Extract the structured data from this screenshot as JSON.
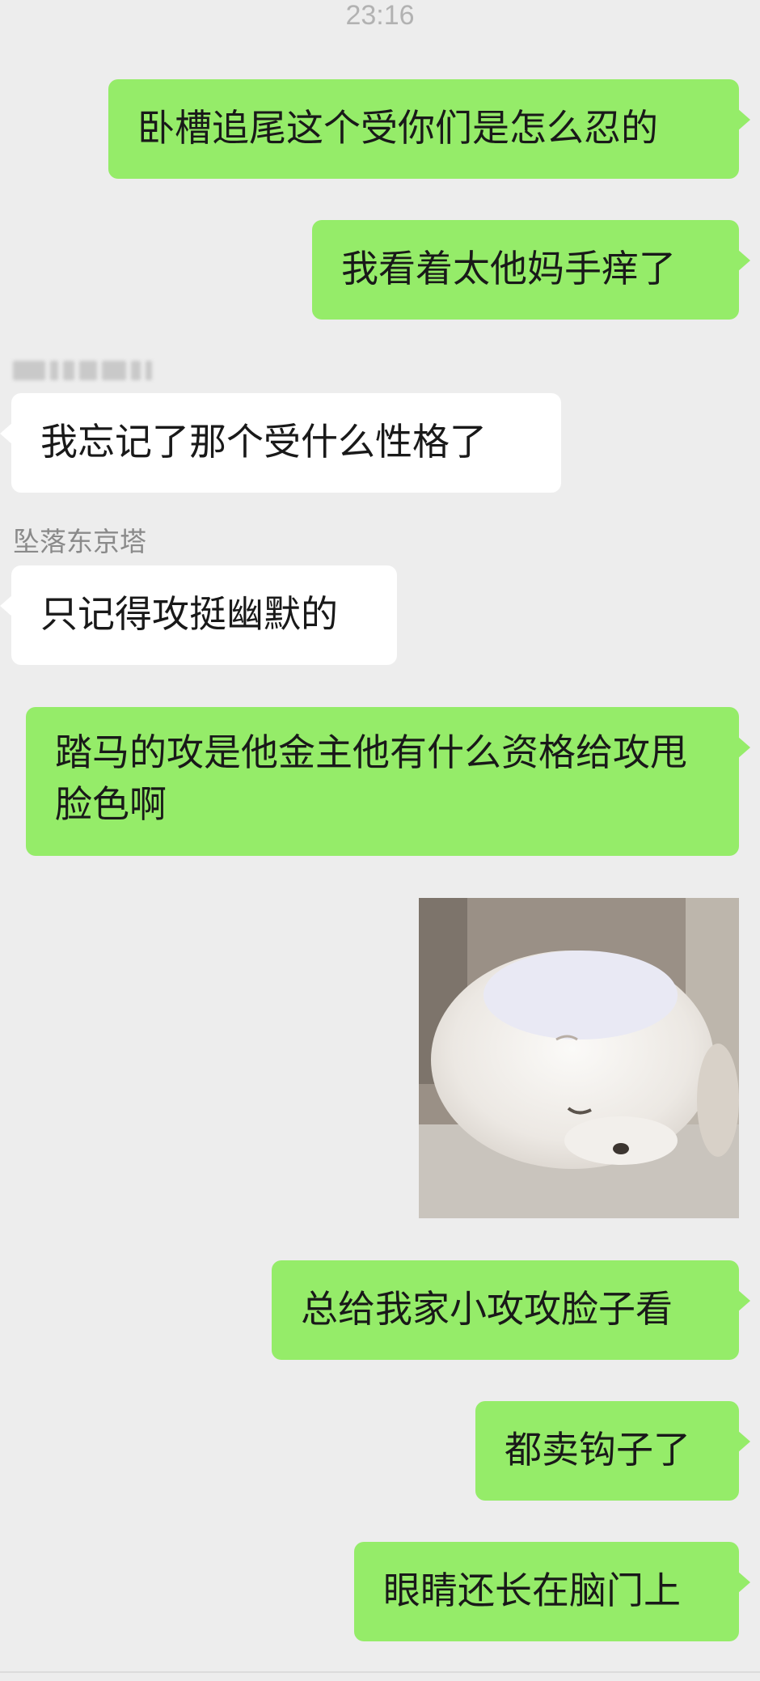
{
  "chat": {
    "timestamp": "23:16",
    "sender_name": "坠落东京塔",
    "messages": {
      "m1": "卧槽追尾这个受你们是怎么忍的",
      "m2": "我看着太他妈手痒了",
      "m3": "我忘记了那个受什么性格了",
      "m4": "只记得攻挺幽默的",
      "m5": "踏马的攻是他金主他有什么资格给攻甩脸色啊",
      "m7": "总给我家小攻攻脸子看",
      "m8": "都卖钩子了",
      "m9": "眼睛还长在脑门上"
    }
  },
  "colors": {
    "background": "#ededed",
    "outgoing_bubble": "#95ec69",
    "incoming_bubble": "#ffffff"
  }
}
